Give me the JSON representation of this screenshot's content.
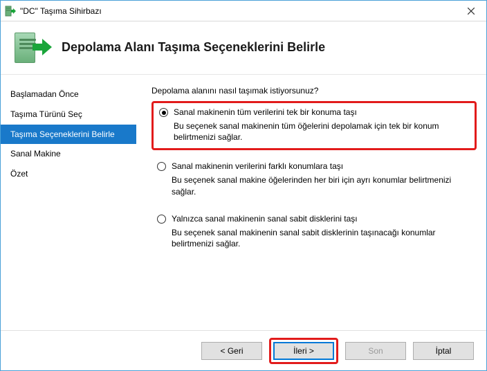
{
  "window": {
    "title": "\"DC\" Taşıma Sihirbazı"
  },
  "header": {
    "title": "Depolama Alanı Taşıma Seçeneklerini Belirle"
  },
  "sidebar": {
    "steps": [
      {
        "label": "Başlamadan Önce"
      },
      {
        "label": "Taşıma Türünü Seç"
      },
      {
        "label": "Taşıma Seçeneklerini Belirle"
      },
      {
        "label": "Sanal Makine"
      },
      {
        "label": "Özet"
      }
    ],
    "active_index": 2
  },
  "content": {
    "prompt": "Depolama alanını nasıl taşımak istiyorsunuz?",
    "options": [
      {
        "title": "Sanal makinenin tüm verilerini tek bir konuma taşı",
        "description": "Bu seçenek sanal makinenin tüm öğelerini depolamak için tek bir konum belirtmenizi sağlar.",
        "checked": true,
        "highlighted": true
      },
      {
        "title": "Sanal makinenin verilerini farklı konumlara taşı",
        "description": "Bu seçenek sanal makine öğelerinden her biri için ayrı konumlar belirtmenizi sağlar.",
        "checked": false,
        "highlighted": false
      },
      {
        "title": "Yalnızca sanal makinenin sanal sabit disklerini taşı",
        "description": "Bu seçenek sanal makinenin sanal sabit disklerinin taşınacağı konumlar belirtmenizi sağlar.",
        "checked": false,
        "highlighted": false
      }
    ]
  },
  "footer": {
    "back": "< Geri",
    "next": "İleri >",
    "finish": "Son",
    "cancel": "İptal"
  }
}
